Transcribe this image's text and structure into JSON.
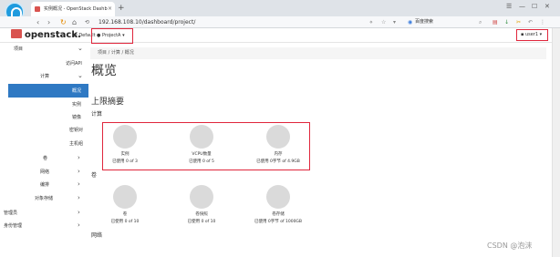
{
  "browser": {
    "tab_title": "实例概况 - OpenStack Dashb",
    "tab_close": "×",
    "new_tab": "+",
    "url": "192.168.108.10/dashboard/project/",
    "search_engine": "百度搜索",
    "window_controls": [
      "☰",
      "—",
      "☐",
      "✕"
    ]
  },
  "header": {
    "brand": "openstack.",
    "domain_label": "Default",
    "project_label": "ProjectA ▾",
    "user_label": "user1 ▾"
  },
  "sidebar": {
    "items": [
      {
        "label": "项目",
        "chevron": "⌄"
      },
      {
        "label": "访问API"
      },
      {
        "label": "计算",
        "chevron": "⌄"
      },
      {
        "label": "概况"
      },
      {
        "label": "实例"
      },
      {
        "label": "镜像"
      },
      {
        "label": "密钥对"
      },
      {
        "label": "主机组"
      },
      {
        "label": "卷",
        "chevron": "›"
      },
      {
        "label": "网络",
        "chevron": "›"
      },
      {
        "label": "编排",
        "chevron": "›"
      },
      {
        "label": "对象存储",
        "chevron": "›"
      },
      {
        "label": "管理员",
        "chevron": "›"
      },
      {
        "label": "身份管理",
        "chevron": "›"
      }
    ]
  },
  "main": {
    "breadcrumb": "项目 / 计算 / 概况",
    "title": "概览",
    "limits_title": "上限摘要",
    "compute_label": "计算",
    "volume_label": "卷",
    "network_label": "网络",
    "compute": [
      {
        "name": "实例",
        "usage": "已使用 0 of 3"
      },
      {
        "name": "VCPU数量",
        "usage": "已使用 0 of 5"
      },
      {
        "name": "内存",
        "usage": "已使用 0字节 of 4.9GB"
      }
    ],
    "volume": [
      {
        "name": "卷",
        "usage": "已使用 0 of 10"
      },
      {
        "name": "卷快照",
        "usage": "已使用 0 of 10"
      },
      {
        "name": "卷存储",
        "usage": "已使用 0字节 of 1000GB"
      }
    ]
  },
  "watermark": "CSDN @泡沫"
}
